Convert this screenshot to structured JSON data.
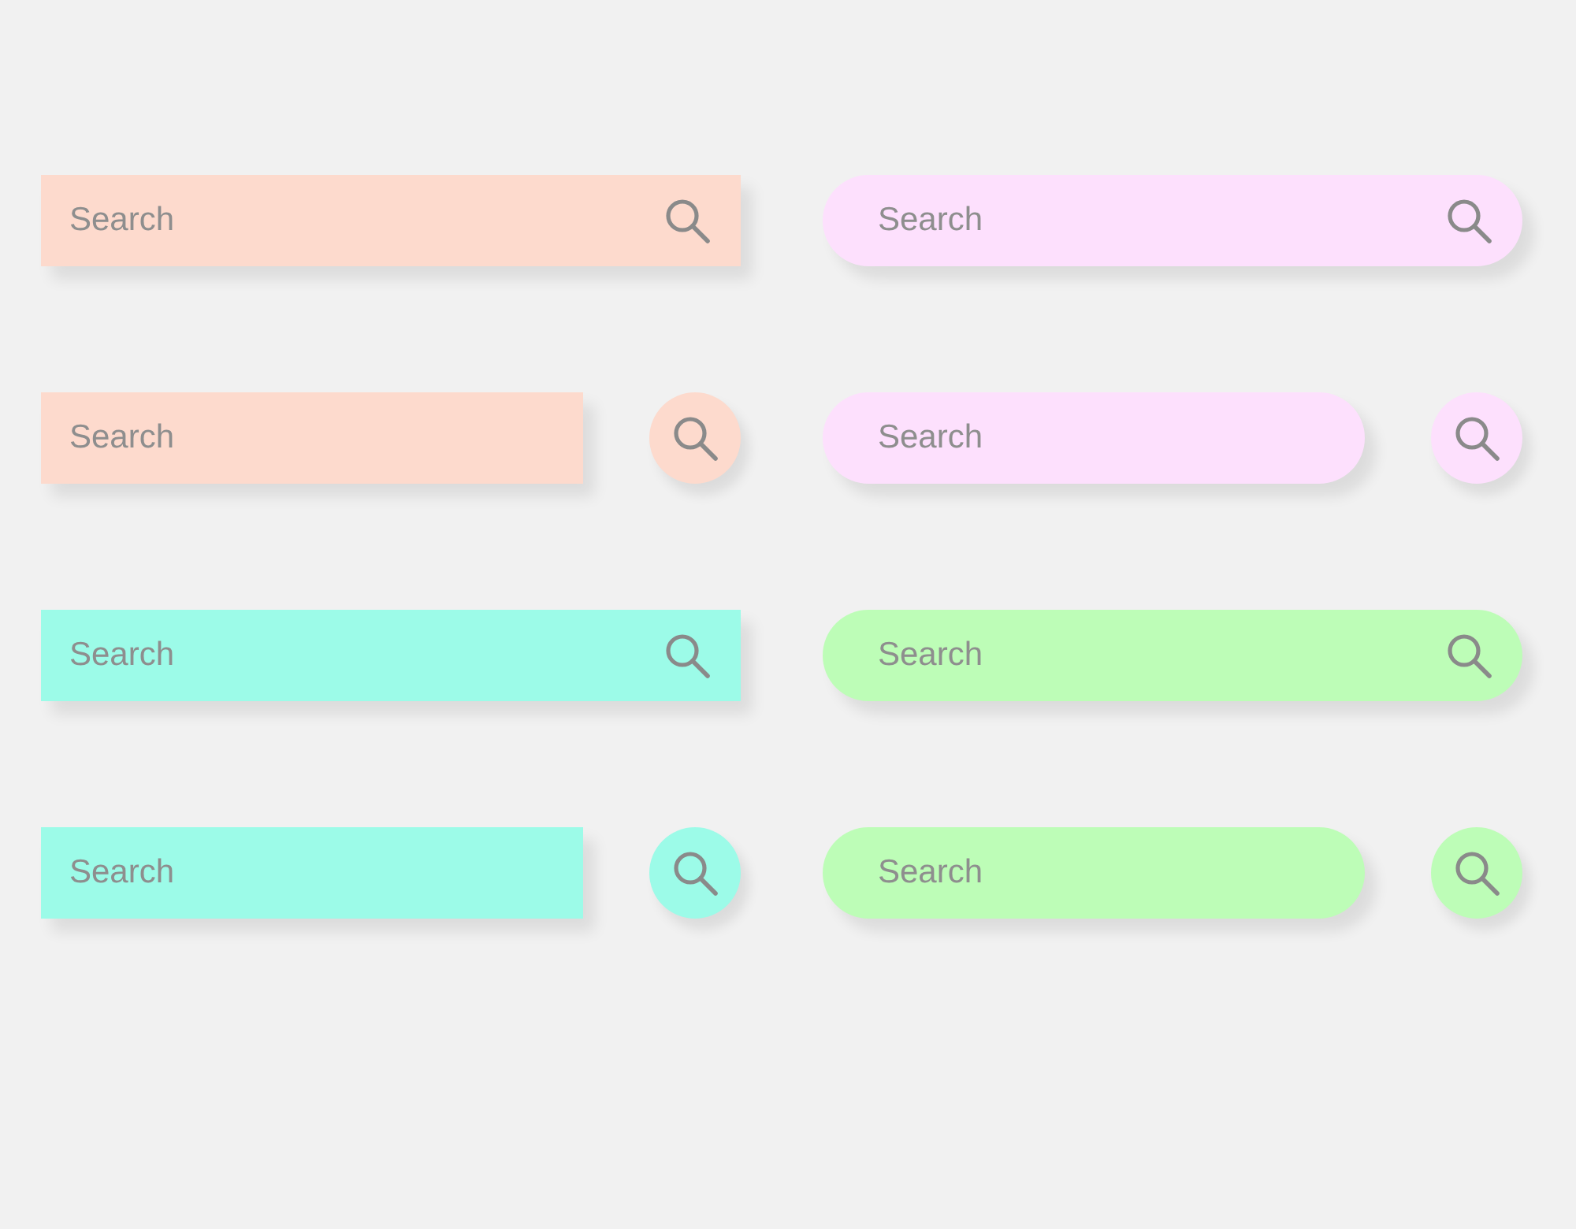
{
  "search_bars": [
    {
      "kind": "square",
      "color": "#fddacd",
      "placeholder": "Search"
    },
    {
      "kind": "pill",
      "color": "#fde0fd",
      "placeholder": "Search"
    },
    {
      "kind": "square-split",
      "color": "#fddacd",
      "placeholder": "Search"
    },
    {
      "kind": "pill-split",
      "color": "#fde0fd",
      "placeholder": "Search"
    },
    {
      "kind": "square",
      "color": "#9cfbe8",
      "placeholder": "Search"
    },
    {
      "kind": "pill",
      "color": "#bdfdb7",
      "placeholder": "Search"
    },
    {
      "kind": "square-split",
      "color": "#9cfbe8",
      "placeholder": "Search"
    },
    {
      "kind": "pill-split",
      "color": "#bdfdb7",
      "placeholder": "Search"
    }
  ]
}
